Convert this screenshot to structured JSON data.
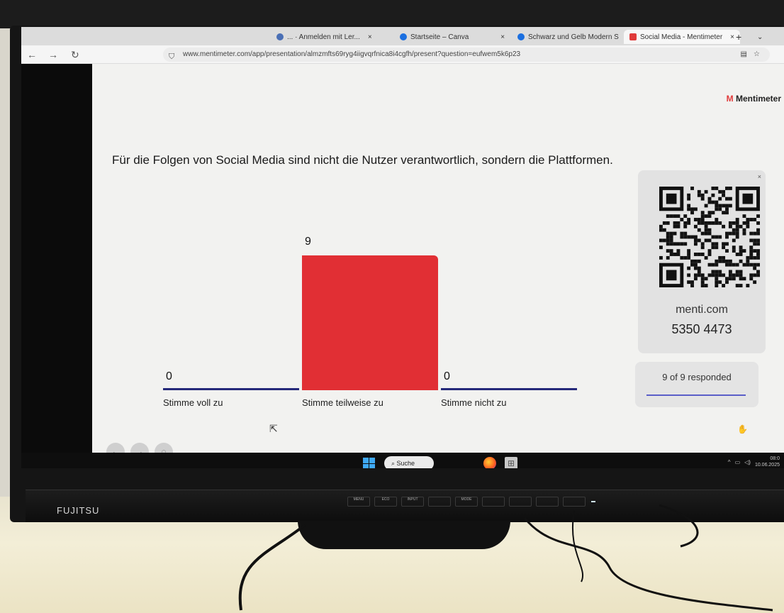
{
  "browser": {
    "tabs": [
      {
        "label": "... · Anmelden mit Ler...",
        "icon": "doc-icon",
        "color": "#4a6fb5"
      },
      {
        "label": "Startseite – Canva",
        "icon": "canva-icon",
        "color": "#1b6fe0"
      },
      {
        "label": "Schwarz und Gelb Modern S",
        "icon": "canva-icon",
        "color": "#1b6fe0"
      },
      {
        "label": "Social Media - Mentimeter",
        "icon": "mentimeter-icon",
        "color": "#e03a3a"
      }
    ],
    "url": "www.mentimeter.com/app/presentation/almzmfts69ryg4iigvqrfnica8i4cgfh/present?question=eufwem5k6p23"
  },
  "slide": {
    "brand": "Mentimeter",
    "question": "Für die Folgen von Social Media sind nicht die Nutzer verantwortlich, sondern die Plattformen.",
    "join_url": "menti.com",
    "join_code": "5350 4473",
    "responses": "9 of 9 responded"
  },
  "chart_data": {
    "type": "bar",
    "categories": [
      "Stimme voll zu",
      "Stimme teilweise zu",
      "Stimme nicht zu"
    ],
    "values": [
      0,
      9,
      0
    ],
    "colors": [
      "#25297a",
      "#e12f34",
      "#25297a"
    ],
    "ylim": [
      0,
      9
    ]
  },
  "taskbar": {
    "search_label": "Suche",
    "time": "08:0",
    "date": "10.06.2025"
  },
  "monitor": {
    "brand": "FUJITSU",
    "buttons": [
      "MENU",
      "ECO",
      "INPUT",
      "",
      "MODE",
      "",
      "",
      "",
      ""
    ]
  }
}
